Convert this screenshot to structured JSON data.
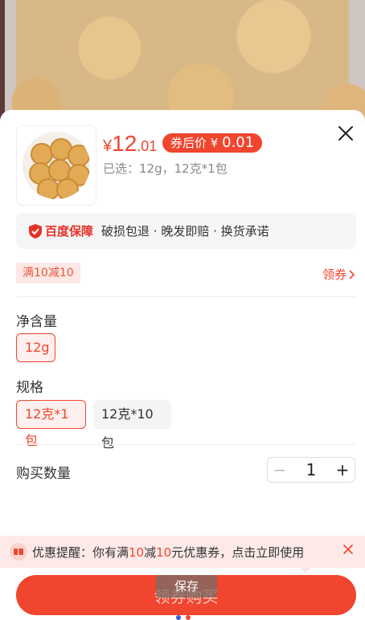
{
  "product": {
    "price_symbol": "¥",
    "price_integer": "12",
    "price_decimal": ".01",
    "coupon_price_label": "券后价",
    "coupon_price_symbol": "¥",
    "coupon_price_value": "0.01",
    "selected_text": "已选：12g，12克*1包"
  },
  "guarantee": {
    "brand": "百度保障",
    "terms": "破损包退 · 晚发即赔 · 换货承诺"
  },
  "promo": {
    "tag": "满10减10",
    "get_coupon_label": "领券"
  },
  "options": {
    "net_weight_title": "净含量",
    "net_weight_values": [
      "12g"
    ],
    "spec_title": "规格",
    "spec_values": [
      "12克*1包",
      "12克*10包"
    ]
  },
  "quantity": {
    "label": "购买数量",
    "value": "1",
    "minus": "−",
    "plus": "+"
  },
  "reminder": {
    "prefix": "优惠提醒：你有满",
    "n1": "10",
    "mid": "减",
    "n2": "10",
    "suffix": "元优惠券，点击立即使用"
  },
  "buy_button_label": "领券购买",
  "save_tip": "保存",
  "colors": {
    "accent": "#f0452e",
    "tag_bg": "#fde8e6"
  },
  "icons": {
    "close": "close-icon",
    "shield": "shield-icon",
    "chevron": "chevron-right-icon",
    "ticket": "ticket-icon"
  }
}
